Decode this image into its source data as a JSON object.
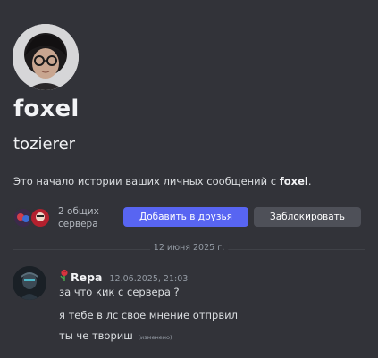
{
  "profile": {
    "display_name": "foxel",
    "username": "tozierer",
    "intro_prefix": "Это начало истории ваших личных сообщений с ",
    "intro_name": "foxel",
    "intro_suffix": "."
  },
  "mutual": {
    "count_label": "2 общих сервера",
    "icons": [
      "server-icon-1",
      "server-icon-2"
    ]
  },
  "actions": {
    "add_friend_label": "Добавить в друзья",
    "block_label": "Заблокировать"
  },
  "divider": {
    "date_label": "12 июня 2025 г."
  },
  "message": {
    "author": "Repa",
    "timestamp": "12.06.2025, 21:03",
    "lines": [
      "за что кик с сервера ?",
      "я тебе в лс свое мнение отпрвил",
      "ты че твориш"
    ],
    "edited_label": "(изменено)"
  },
  "colors": {
    "background": "#323339",
    "primary_button": "#5865f2",
    "secondary_button": "#4e5058"
  }
}
